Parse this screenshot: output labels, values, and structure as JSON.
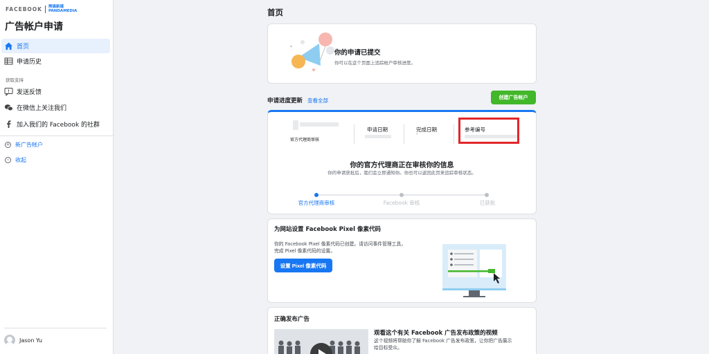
{
  "brand": {
    "facebook": "FACEBOOK",
    "partner_cn": "熊猫新媒",
    "partner_en": "PANDAMEDIA"
  },
  "sidebar": {
    "title": "广告帐户申请",
    "items": [
      {
        "label": "首页",
        "icon": "home-icon"
      },
      {
        "label": "申请历史",
        "icon": "table-icon"
      }
    ],
    "support_label": "获取支持",
    "support_items": [
      {
        "label": "发送反馈",
        "icon": "feedback-icon"
      },
      {
        "label": "在微信上关注我们",
        "icon": "wechat-icon"
      },
      {
        "label": "加入我们的 Facebook 的社群",
        "icon": "facebook-icon"
      }
    ],
    "new_account": "新广告帐户",
    "collapse": "收起",
    "user_name": "Jason Yu"
  },
  "main": {
    "page_title": "首页",
    "submitted": {
      "title": "你的申请已提交",
      "subtitle": "你可以在这个页面上追踪帐户审核进度。"
    },
    "progress": {
      "section_title": "申请进度更新",
      "view_all": "查看全部",
      "create_button": "创建广告帐户",
      "agency_label": "官方代理商审核",
      "apply_date_label": "申请日期",
      "done_date_label": "完成日期",
      "done_date_value": "-",
      "ref_label": "参考编号",
      "status_title": "你的官方代理商正在审核你的信息",
      "status_text": "你的申请获批后，我们会立即通知你。你也可以返回此页来追踪审核状态。",
      "steps": [
        "官方代理商审核",
        "Facebook 审核",
        "已获批"
      ],
      "accent": "#1877f2"
    },
    "pixel": {
      "title": "为网站设置 Facebook Pixel 像素代码",
      "text1": "你的 Facebook Pixel 像素代码已创建。请访问事件管理工具，",
      "text2": "完成 Pixel 像素代码的设置。",
      "button": "设置 Pixel 像素代码"
    },
    "ads": {
      "title": "正确发布广告",
      "video_title": "观看这个有关 Facebook 广告发布政策的视频",
      "video_text1": "这个视频将帮助你了解 Facebook 广告发布政策，让你把广告展示",
      "video_text2": "给目标受众。"
    }
  }
}
